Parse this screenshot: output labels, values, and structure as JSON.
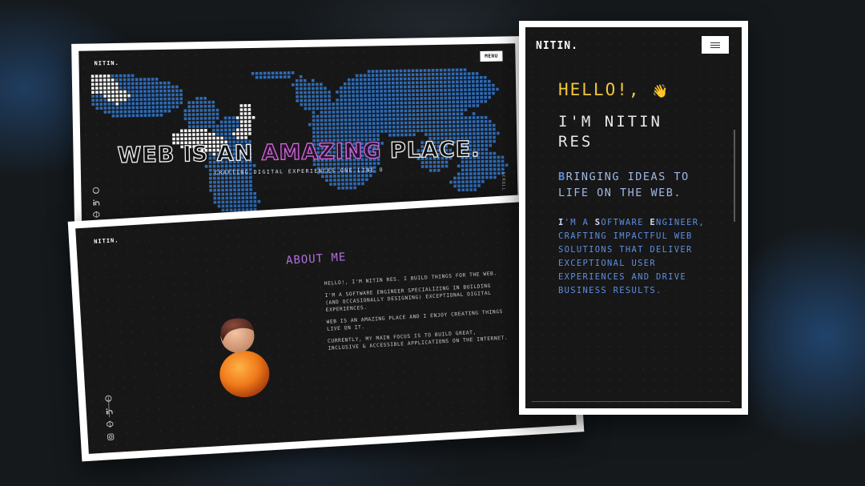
{
  "hero": {
    "logo": "NITIN.",
    "menu": "MENU",
    "headline_part1": "WEB IS AN ",
    "headline_amazing": "AMAZING",
    "headline_part2": " PLACE.",
    "subheadline": "CRAFTING DIGITAL EXPERIENCES ONE LINE O",
    "side_vertical": "SCROLL",
    "social_icons": [
      "github-icon",
      "linkedin-icon",
      "codepen-icon"
    ]
  },
  "about": {
    "logo": "NITIN.",
    "title": "ABOUT ME",
    "paragraphs": [
      "HELLO!, I'M NITIN RES. I BUILD THINGS FOR THE WEB.",
      "I'M A SOFTWARE ENGINEER SPECIALIZING IN BUILDING (AND OCCASIONALLY DESIGNING) EXCEPTIONAL DIGITAL EXPERIENCES.",
      "WEB IS AN AMAZING PLACE AND I ENJOY CREATING THINGS LIVE ON IT.",
      "CURRENTLY, MY MAIN FOCUS IS TO BUILD GREAT, INCLUSIVE & ACCESSIBLE APPLICATIONS ON THE INTERNET."
    ],
    "social_icons": [
      "github-icon",
      "linkedin-icon",
      "codepen-icon",
      "instagram-icon"
    ]
  },
  "mobile": {
    "logo": "NITIN.",
    "hello": "HELLO!,",
    "wave": "👋",
    "name_line1": "I'M NITIN",
    "name_line2": "RES",
    "tagline_first": "B",
    "tagline_rest": "RINGING IDEAS TO LIFE ON THE WEB.",
    "bio_parts": [
      "I",
      "'M A ",
      "S",
      "OFTWARE ",
      "E",
      "NGINEER, CRAFTING IMPACTFUL WEB SOLUTIONS THAT DELIVER EXCEPTIONAL USER EXPERIENCES AND DRIVE BUSINESS RESULTS."
    ]
  },
  "colors": {
    "accent_purple": "#b26ee0",
    "accent_yellow": "#f0c63a",
    "accent_blue": "#5e8ee0",
    "map_blue": "#2f6bb5"
  }
}
